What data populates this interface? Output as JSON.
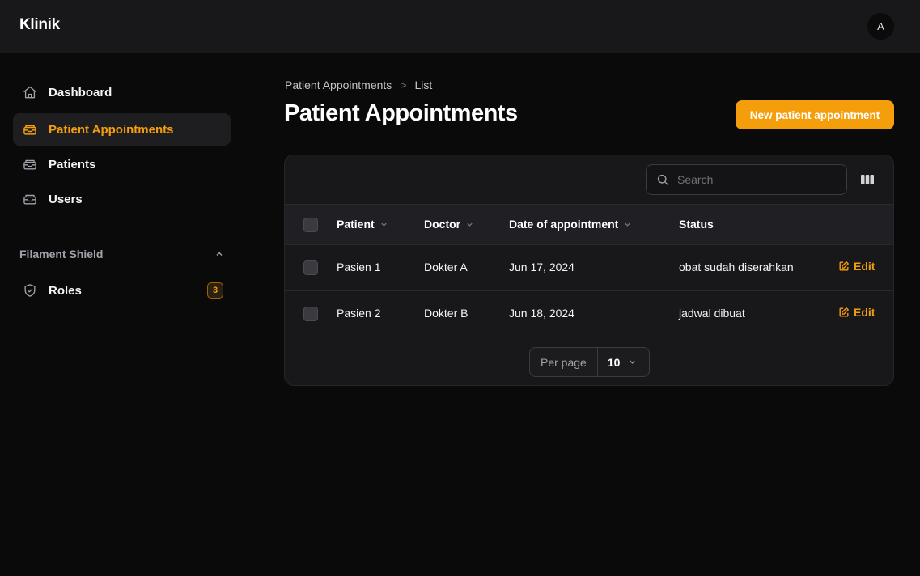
{
  "app": {
    "title": "Klinik",
    "user_initial": "A"
  },
  "sidebar": {
    "items": [
      {
        "label": "Dashboard",
        "icon": "home-icon",
        "active": false
      },
      {
        "label": "Patient Appointments",
        "icon": "inbox-stack-icon",
        "active": true
      },
      {
        "label": "Patients",
        "icon": "inbox-stack-icon",
        "active": false
      },
      {
        "label": "Users",
        "icon": "inbox-stack-icon",
        "active": false
      }
    ],
    "group": {
      "label": "Filament Shield",
      "items": [
        {
          "label": "Roles",
          "icon": "shield-check-icon",
          "badge": "3"
        }
      ]
    }
  },
  "breadcrumb": {
    "parent": "Patient Appointments",
    "separator": ">",
    "current": "List"
  },
  "page": {
    "title": "Patient Appointments",
    "new_button": "New patient appointment"
  },
  "table": {
    "search_placeholder": "Search",
    "columns": [
      "Patient",
      "Doctor",
      "Date of appointment",
      "Status"
    ],
    "rows": [
      {
        "patient": "Pasien 1",
        "doctor": "Dokter A",
        "date": "Jun 17, 2024",
        "status": "obat sudah diserahkan",
        "action": "Edit"
      },
      {
        "patient": "Pasien 2",
        "doctor": "Dokter B",
        "date": "Jun 18, 2024",
        "status": "jadwal dibuat",
        "action": "Edit"
      }
    ],
    "per_page_label": "Per page",
    "per_page_value": "10"
  },
  "colors": {
    "accent": "#f59e0b",
    "background": "#0a0a0b",
    "panel": "#18181b"
  }
}
